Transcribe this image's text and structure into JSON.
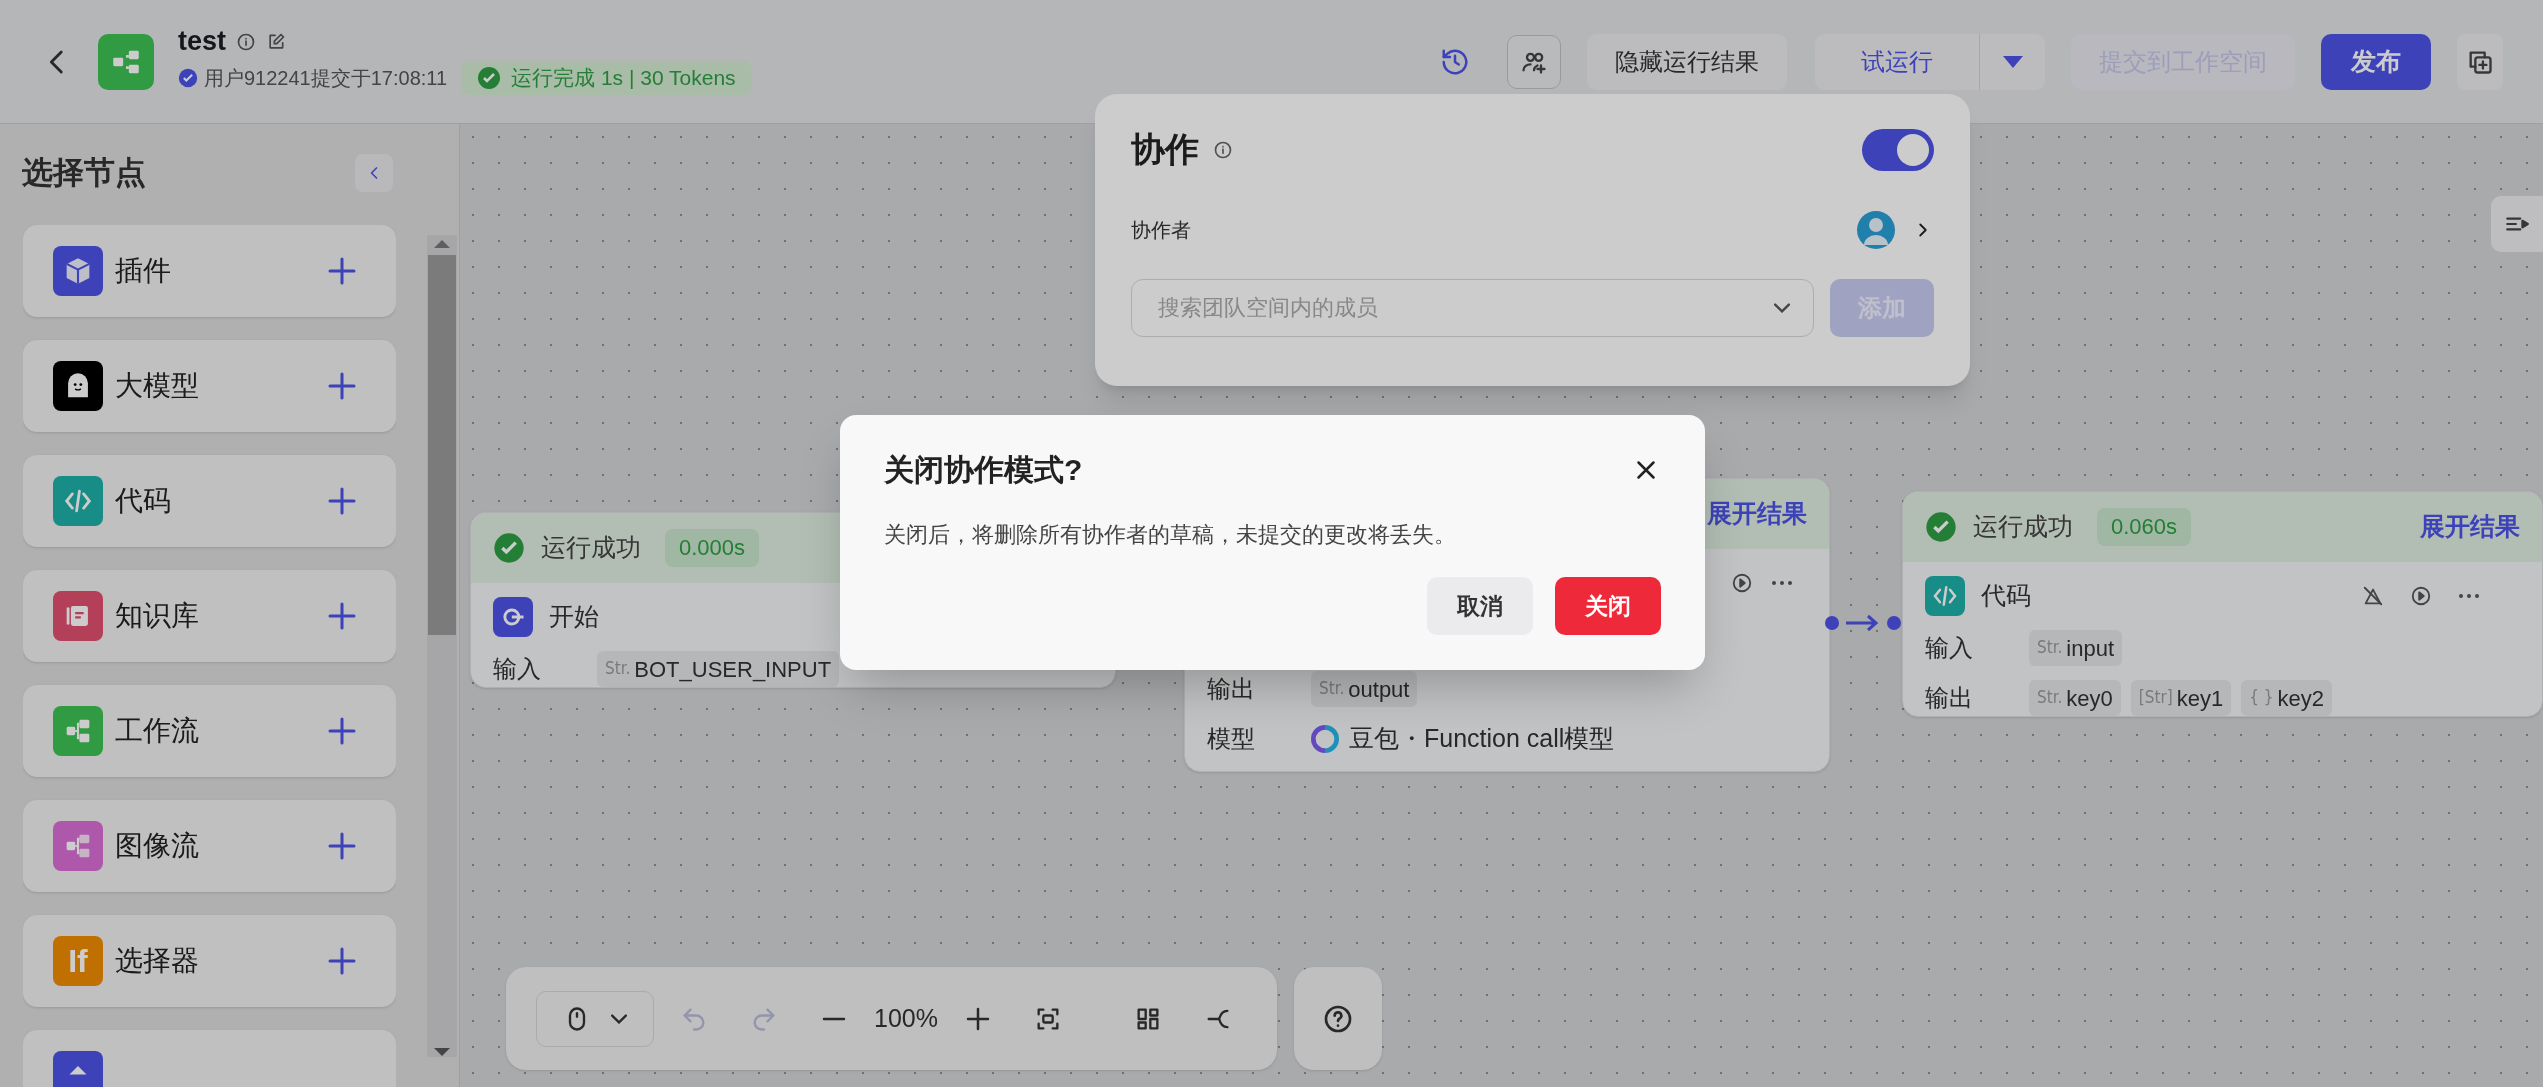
{
  "header": {
    "title": "test",
    "submitter": "用户912241提交于17:08:11",
    "run_status": "运行完成 1s | 30 Tokens",
    "hide_results": "隐藏运行结果",
    "test_run": "试运行",
    "submit": {
      "label": "提交到工作空间",
      "disabled": true
    },
    "publish": "发布"
  },
  "sidebar": {
    "title": "选择节点",
    "items": [
      {
        "label": "插件",
        "kind": "plugin"
      },
      {
        "label": "大模型",
        "kind": "llm"
      },
      {
        "label": "代码",
        "kind": "code"
      },
      {
        "label": "知识库",
        "kind": "knowledge"
      },
      {
        "label": "工作流",
        "kind": "workflow"
      },
      {
        "label": "图像流",
        "kind": "imageflow"
      },
      {
        "label": "选择器",
        "kind": "condition",
        "icon_text": "If"
      },
      {
        "kind": "partial"
      }
    ]
  },
  "nodes": [
    {
      "kind": "start",
      "status": "运行成功",
      "time": "0.000s",
      "title": "开始",
      "rows": [
        {
          "label": "输入",
          "kind": "params",
          "params": [
            {
              "type": "Str.",
              "name": "BOT_USER_INPUT"
            }
          ]
        }
      ]
    },
    {
      "kind": "llm",
      "expand": "展开结果",
      "rows": [
        {
          "label": "输出",
          "kind": "params",
          "params": [
            {
              "type": "Str.",
              "name": "output"
            }
          ]
        },
        {
          "label": "模型",
          "kind": "model",
          "value": "豆包・Function call模型"
        }
      ]
    },
    {
      "kind": "code",
      "status": "运行成功",
      "time": "0.060s",
      "expand": "展开结果",
      "title": "代码",
      "rows": [
        {
          "label": "输入",
          "kind": "params",
          "params": [
            {
              "type": "Str.",
              "name": "input"
            }
          ]
        },
        {
          "label": "输出",
          "kind": "params",
          "params": [
            {
              "type": "Str.",
              "name": "key0"
            },
            {
              "type": "[Str]",
              "name": "key1"
            },
            {
              "type": "{ }",
              "name": "key2"
            }
          ]
        }
      ]
    }
  ],
  "collab_popup": {
    "title": "协作",
    "on": true,
    "collaborators_label": "协作者",
    "search_placeholder": "搜索团队空间内的成员",
    "add_button": {
      "label": "添加",
      "disabled": true
    }
  },
  "zoom_bar": {
    "zoom": "100%"
  },
  "dialog": {
    "title": "关闭协作模式?",
    "message": "关闭后，将删除所有协作者的草稿，未提交的更改将丢失。",
    "cancel": "取消",
    "confirm": "关闭"
  }
}
